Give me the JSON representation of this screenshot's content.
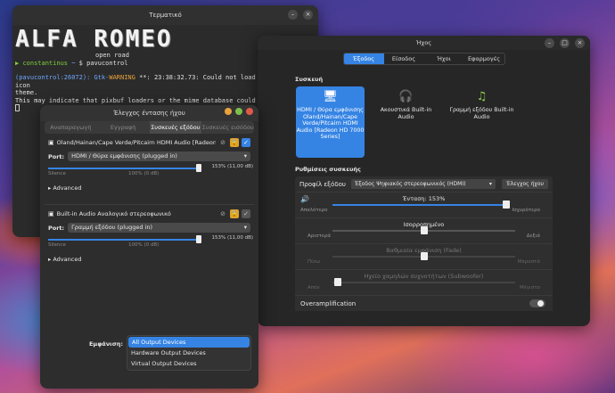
{
  "terminal": {
    "title": "Τερματικό",
    "ascii_art": "ALFA ROMEO",
    "ascii_sub": "open road",
    "prompt_user": "constantinus",
    "prompt_dir": "~",
    "prompt_symbol": "$",
    "command": "pavucontrol",
    "warn_prefix": "(pavucontrol:26072): Gtk-",
    "warn_level": "WARNING",
    "warn_rest": " **: 23:38:32.73: Could not load a pixbuf from icon",
    "line2": "theme.",
    "line3": "This may indicate that pixbuf loaders or the mime database could not be"
  },
  "volume": {
    "title": "Έλεγχος έντασης ήχου",
    "tabs": [
      "Αναπαραγωγή",
      "Εγγραφή",
      "Συσκευές εξόδου",
      "Συσκευές εισόδου"
    ],
    "devices": [
      {
        "name": "Oland/Hainan/Cape Verde/Pitcairn HDMI Audio [Radeon HD 7000 Series]",
        "port_label": "Port:",
        "port_value": "HDMI / Θύρα εμφάνισης (plugged in)",
        "level": 1.53,
        "silence": "Silence",
        "hundred": "100% (0 dB)",
        "value_text": "153% (11,00 dB)",
        "advanced": "Advanced"
      },
      {
        "name": "Built-in Audio Αναλογικό στερεοφωνικό",
        "port_label": "Port:",
        "port_value": "Γραμμή εξόδου (plugged in)",
        "level": 1.53,
        "silence": "Silence",
        "hundred": "100% (0 dB)",
        "value_text": "153% (11,00 dB)",
        "advanced": "Advanced"
      }
    ],
    "show_label": "Εμφάνιση:",
    "show_options": [
      "All Output Devices",
      "Hardware Output Devices",
      "Virtual Output Devices"
    ]
  },
  "sound": {
    "title": "Ήχος",
    "tabs": [
      "Έξοδος",
      "Είσοδος",
      "Ήχοι",
      "Εφαρμογές"
    ],
    "device_section": "Συσκευή",
    "devices": [
      {
        "label": "HDMI / Θύρα εμφάνισης Oland/Hainan/Cape Verde/Pitcairn HDMI Audio [Radeon HD 7000 Series]",
        "icon": "monitor-icon"
      },
      {
        "label": "Ακουστικά Built-in Audio",
        "icon": "headphones-icon"
      },
      {
        "label": "Γραμμή εξόδου Built-in Audio",
        "icon": "line-out-icon"
      }
    ],
    "settings_section": "Ρυθμίσεις συσκευής",
    "profile_label": "Προφίλ εξόδου",
    "profile_value": "Έξοδος Ψηφιακός στερεοφωνικός (HDMI)",
    "test_button": "Έλεγχος ήχου",
    "volume_title": "Ένταση: 153%",
    "volume_level": 1.53,
    "volume_min": "Απαλότερο",
    "volume_max": "Ισχυρότερο",
    "balance_title": "Ισορροπημένο",
    "balance_left": "Αριστερά",
    "balance_right": "Δεξιά",
    "fade_title": "Βαθμιαία εμφάνιση (Fade)",
    "fade_left": "Πίσω",
    "fade_right": "Μπροστά",
    "sub_title": "Ηχείο χαμηλών συχνοτήτων (Subwoofer)",
    "sub_left": "Απόν",
    "sub_right": "Μέγιστο",
    "overamp_label": "Overamplification"
  }
}
